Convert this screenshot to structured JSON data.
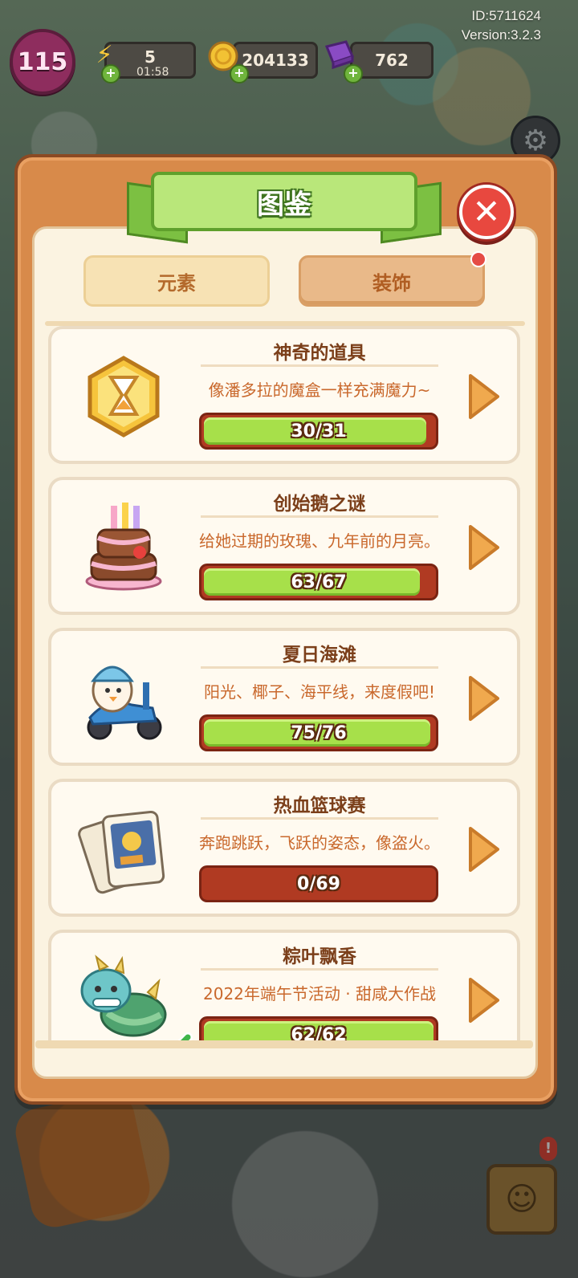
{
  "hud": {
    "level": "115",
    "energy": "5",
    "energy_timer": "01:58",
    "coins": "204133",
    "gems": "762",
    "id_line": "ID:5711624",
    "version_line": "Version:3.2.3",
    "icons": {
      "energy": "lightning-icon",
      "coins": "coin-icon",
      "gems": "gem-icon",
      "settings": "gear-icon"
    }
  },
  "modal": {
    "title": "图鉴",
    "tabs": [
      {
        "label": "元素",
        "selected": false
      },
      {
        "label": "装饰",
        "selected": true
      }
    ],
    "items": [
      {
        "title": "神奇的道具",
        "description": "像潘多拉的魔盒一样充满魔力~",
        "progress": "30/31",
        "current": 30,
        "total": 31,
        "icon": "hourglass-icon",
        "completed": false
      },
      {
        "title": "创始鹅之谜",
        "description": "给她过期的玫瑰、九年前的月亮。",
        "progress": "63/67",
        "current": 63,
        "total": 67,
        "icon": "cake-icon",
        "completed": false
      },
      {
        "title": "夏日海滩",
        "description": "阳光、椰子、海平线，来度假吧!",
        "progress": "75/76",
        "current": 75,
        "total": 76,
        "icon": "scooter-goose-icon",
        "completed": false
      },
      {
        "title": "热血篮球赛",
        "description": "奔跑跳跃，飞跃的姿态，像盗火。",
        "progress": "0/69",
        "current": 0,
        "total": 69,
        "icon": "cards-icon",
        "completed": false
      },
      {
        "title": "粽叶飘香",
        "description": "2022年端午节活动 · 甜咸大作战",
        "progress": "62/62",
        "current": 62,
        "total": 62,
        "icon": "dragon-icon",
        "completed": true
      }
    ]
  },
  "colors": {
    "frame": "#d88a4a",
    "panel": "#fbf3e1",
    "progress_fill": "#a7e04a",
    "progress_empty": "#b03a22",
    "title_text": "#7b3f1a",
    "desc_text": "#c9682c"
  }
}
